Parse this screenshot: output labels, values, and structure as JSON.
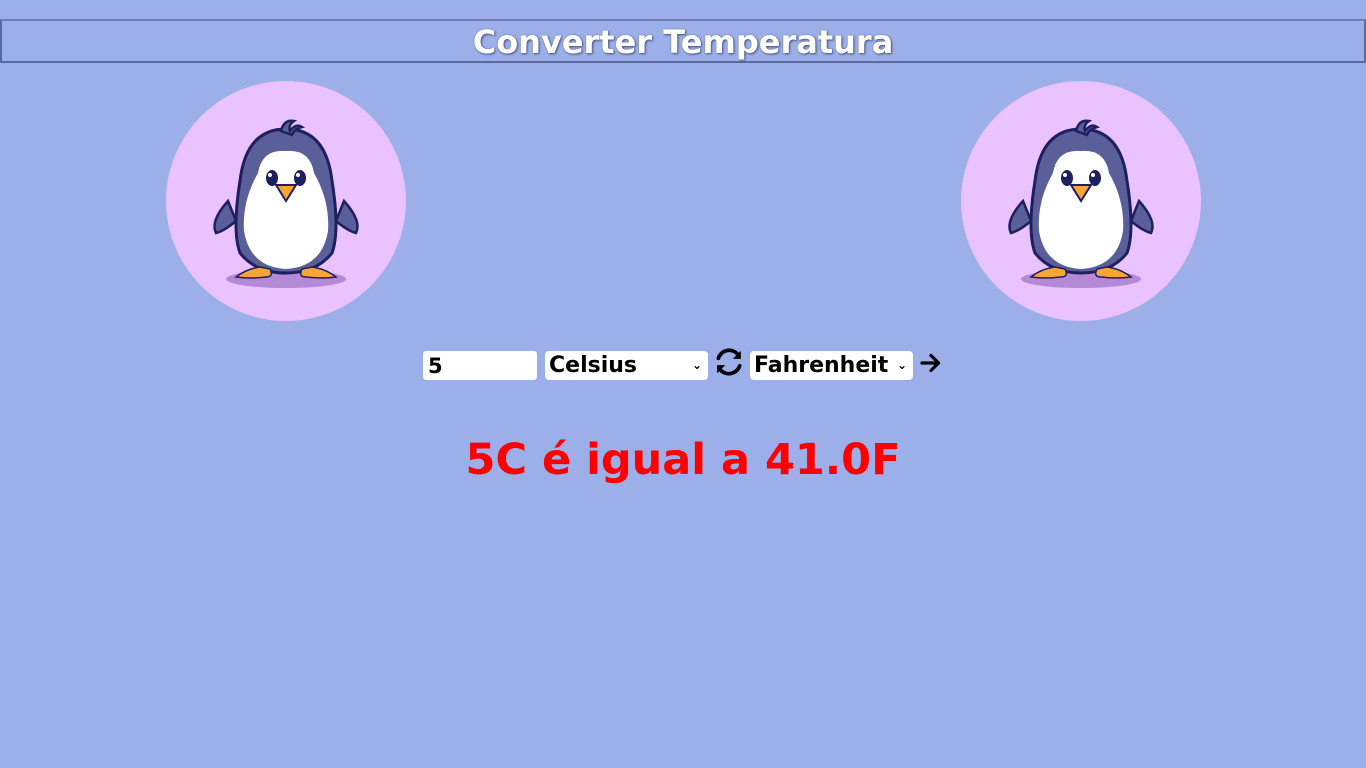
{
  "header": {
    "title": "Converter Temperatura"
  },
  "images": {
    "left_icon": "penguin-icon",
    "right_icon": "penguin-icon",
    "circle_color": "#e9c2ff"
  },
  "converter": {
    "input_value": "5",
    "from_unit": "Celsius",
    "to_unit": "Fahrenheit",
    "swap_icon": "refresh-icon",
    "go_icon": "arrow-right-icon"
  },
  "result": {
    "text": "5C é igual a 41.0F",
    "color": "#ff0000"
  },
  "colors": {
    "background": "#9dafe8",
    "title_text": "#ffffff"
  }
}
